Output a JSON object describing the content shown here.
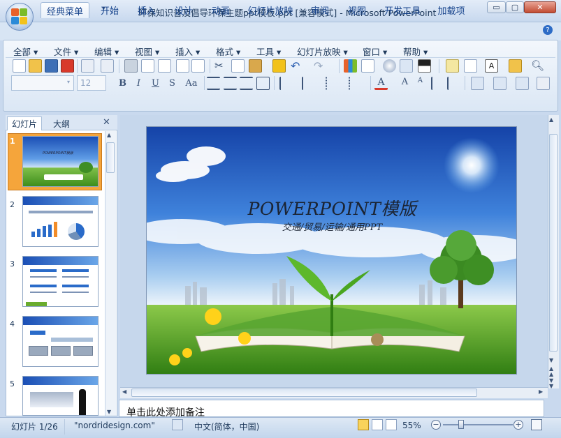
{
  "window": {
    "title": "环保知识普及倡导环保主题ppt模板.ppt [兼容模式] - Microsoft PowerPoint",
    "controls": {
      "minimize": "▭",
      "restore": "▢",
      "close": "✕"
    }
  },
  "tabs": [
    "经典菜单",
    "开始",
    "插入",
    "设计",
    "动画",
    "幻灯片放映",
    "审阅",
    "视图",
    "开发工具",
    "加载项"
  ],
  "menu": [
    "全部",
    "文件",
    "编辑",
    "视图",
    "插入",
    "格式",
    "工具",
    "幻灯片放映",
    "窗口",
    "帮助"
  ],
  "format": {
    "font_size": "12",
    "bold": "B",
    "italic": "I",
    "underline": "U",
    "shadow": "S",
    "case": "Aa"
  },
  "left_pane": {
    "tabs": [
      "幻灯片",
      "大纲"
    ],
    "close": "✕",
    "thumbnails": [
      {
        "num": "1",
        "title": "POWERPOINT模版"
      },
      {
        "num": "2",
        "title": ""
      },
      {
        "num": "3",
        "title": ""
      },
      {
        "num": "4",
        "title": ""
      },
      {
        "num": "5",
        "title": ""
      }
    ]
  },
  "slide": {
    "title": "POWERPOINT模版",
    "subtitle": "交通/贸易/运输/通用PPT"
  },
  "notes": {
    "placeholder": "单击此处添加备注"
  },
  "status": {
    "slide_info": "幻灯片 1/26",
    "theme": "\"nordridesign.com\"",
    "language": "中文(简体，中国)",
    "zoom": "55%"
  },
  "colors": {
    "accent": "#f5a53b",
    "ribbon": "#dbe7f5",
    "frame": "#c6d7ec"
  }
}
